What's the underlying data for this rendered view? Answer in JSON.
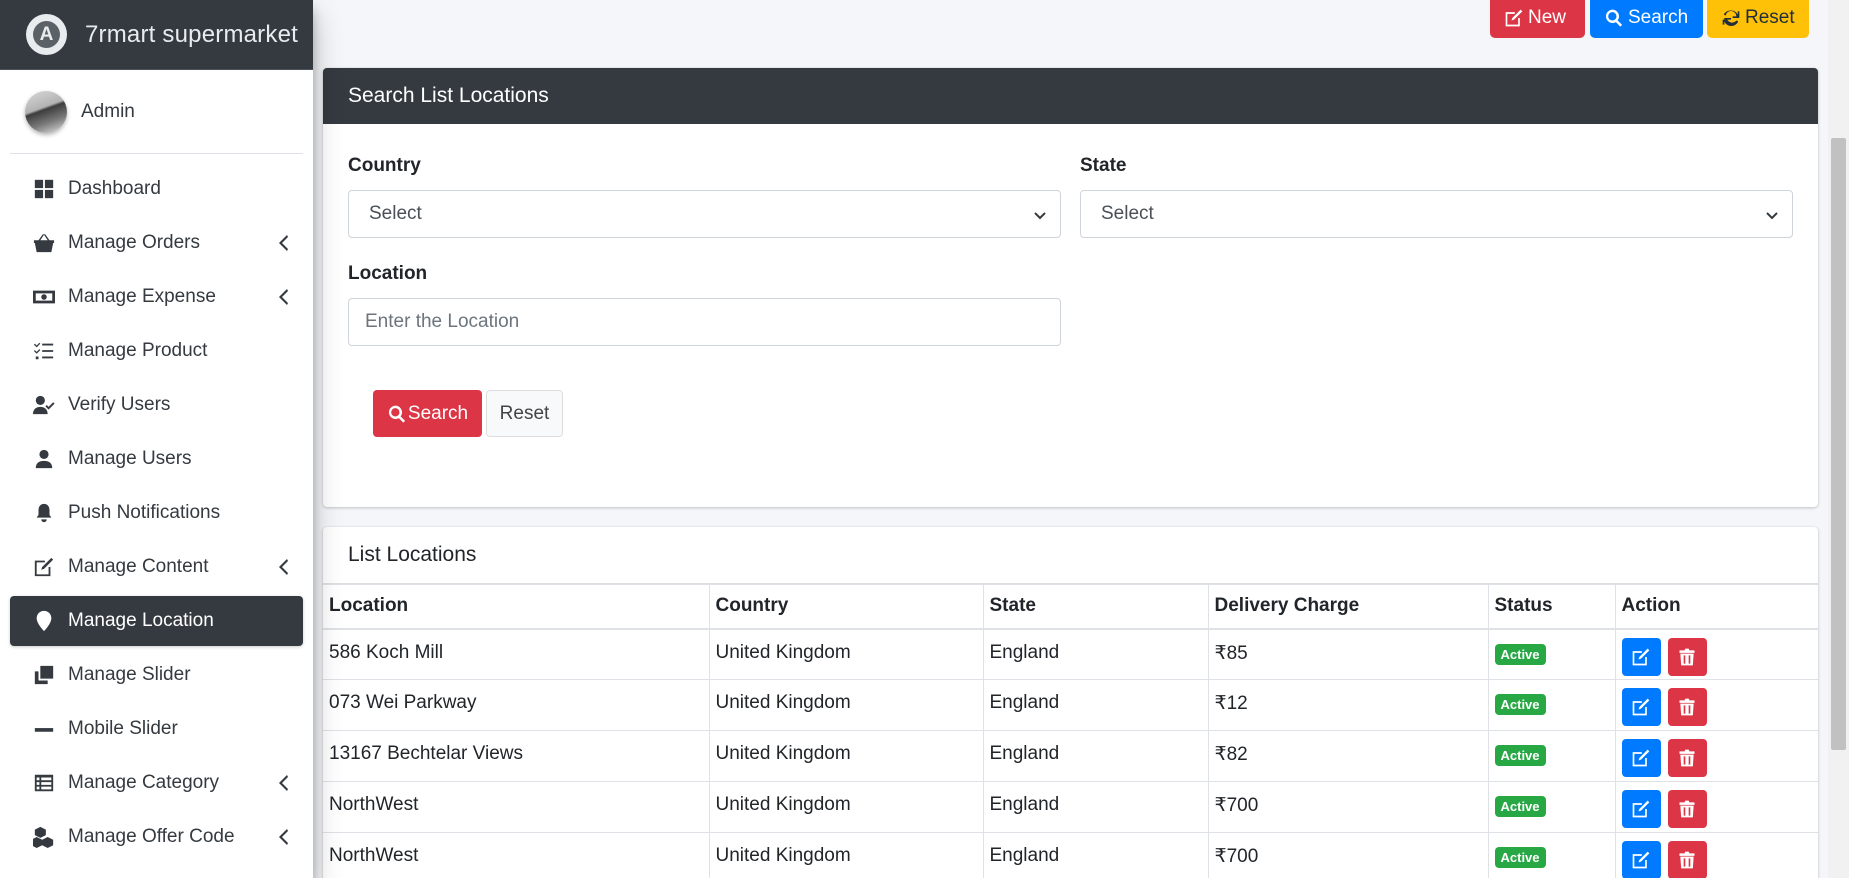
{
  "brand": {
    "name": "7rmart supermarket",
    "logo_letter": "A"
  },
  "user": {
    "name": "Admin"
  },
  "sidebar": {
    "items": [
      {
        "label": "Dashboard",
        "icon": "dashboard-icon",
        "has_submenu": false,
        "active": false
      },
      {
        "label": "Manage Orders",
        "icon": "basket-icon",
        "has_submenu": true,
        "active": false
      },
      {
        "label": "Manage Expense",
        "icon": "money-icon",
        "has_submenu": true,
        "active": false
      },
      {
        "label": "Manage Product",
        "icon": "tasks-icon",
        "has_submenu": false,
        "active": false
      },
      {
        "label": "Verify Users",
        "icon": "user-check-icon",
        "has_submenu": false,
        "active": false
      },
      {
        "label": "Manage Users",
        "icon": "user-icon",
        "has_submenu": false,
        "active": false
      },
      {
        "label": "Push Notifications",
        "icon": "bell-icon",
        "has_submenu": false,
        "active": false
      },
      {
        "label": "Manage Content",
        "icon": "edit-icon",
        "has_submenu": true,
        "active": false
      },
      {
        "label": "Manage Location",
        "icon": "map-marker-icon",
        "has_submenu": false,
        "active": true
      },
      {
        "label": "Manage Slider",
        "icon": "clone-icon",
        "has_submenu": false,
        "active": false
      },
      {
        "label": "Mobile Slider",
        "icon": "minus-icon",
        "has_submenu": false,
        "active": false
      },
      {
        "label": "Manage Category",
        "icon": "list-icon",
        "has_submenu": true,
        "active": true
      },
      {
        "label": "Manage Offer Code",
        "icon": "cubes-icon",
        "has_submenu": true,
        "active": false
      }
    ]
  },
  "toolbar": {
    "new_label": "New",
    "search_label": "Search",
    "reset_label": "Reset"
  },
  "search_card": {
    "title": "Search List Locations",
    "country_label": "Country",
    "country_value": "Select",
    "state_label": "State",
    "state_value": "Select",
    "location_label": "Location",
    "location_placeholder": "Enter the Location",
    "search_button": "Search",
    "reset_button": "Reset"
  },
  "list_card": {
    "title": "List Locations",
    "columns": [
      "Location",
      "Country",
      "State",
      "Delivery Charge",
      "Status",
      "Action"
    ],
    "rows": [
      {
        "location": "586 Koch Mill",
        "country": "United Kingdom",
        "state": "England",
        "charge": "₹85",
        "status": "Active"
      },
      {
        "location": "073 Wei Parkway",
        "country": "United Kingdom",
        "state": "England",
        "charge": "₹12",
        "status": "Active"
      },
      {
        "location": "13167 Bechtelar Views",
        "country": "United Kingdom",
        "state": "England",
        "charge": "₹82",
        "status": "Active"
      },
      {
        "location": "NorthWest",
        "country": "United Kingdom",
        "state": "England",
        "charge": "₹700",
        "status": "Active"
      },
      {
        "location": "NorthWest",
        "country": "United Kingdom",
        "state": "England",
        "charge": "₹700",
        "status": "Active"
      }
    ]
  },
  "colors": {
    "danger": "#dc3545",
    "primary": "#007bff",
    "warning": "#ffc107",
    "success": "#28a745",
    "dark": "#343a40"
  }
}
